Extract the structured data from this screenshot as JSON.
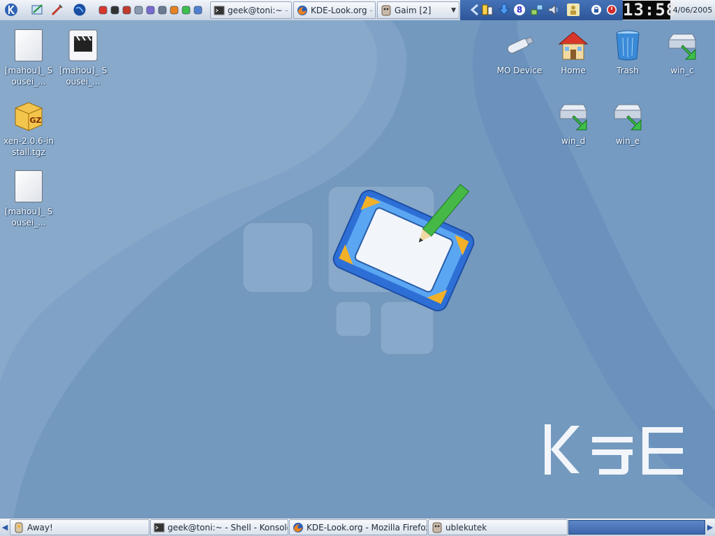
{
  "top_panel": {
    "kmenu_icon": "kde-gear-icon",
    "launchers": [
      "konqueror-icon",
      "netbeans-tools-icon",
      "globe-icon"
    ],
    "mini_launchers": [
      "home-folder-icon",
      "terminal-icon",
      "tools-icon",
      "mail-icon",
      "chat-icon",
      "speaker-icon",
      "firefox-icon",
      "network-icon",
      "browser-icon"
    ],
    "tasks": [
      {
        "label": "geek@toni:~",
        "dim": " - S",
        "icon": "terminal-icon"
      },
      {
        "label": "KDE-Look.org",
        "dim": " -",
        "icon": "firefox-icon"
      },
      {
        "label": "Gaim [2]",
        "dim": "",
        "icon": "gaim-icon"
      }
    ],
    "tray": {
      "icons": [
        "back-arrow-icon",
        "network-monitor-icon",
        "download-icon",
        "chat-count-icon",
        "network-icon",
        "volume-icon",
        "notes-icon",
        "lock-icon",
        "power-icon"
      ],
      "badge": "8"
    },
    "clock": "13:58",
    "date": "4/06/2005"
  },
  "desktop": {
    "left_icons": [
      {
        "label": "[mahou]_ Sousei_...",
        "type": "document"
      },
      {
        "label": "[mahou]_ Sousei_...",
        "type": "video"
      },
      {
        "label": "xen-2.0.6-install.tgz",
        "type": "archive"
      },
      {
        "label": "[mahou]_ Sousei_...",
        "type": "document"
      }
    ],
    "right_icons": [
      {
        "label": "MO Device",
        "type": "usb"
      },
      {
        "label": "Home",
        "type": "home"
      },
      {
        "label": "Trash",
        "type": "trash"
      },
      {
        "label": "win_c",
        "type": "drive"
      },
      {
        "label": "win_d",
        "type": "drive"
      },
      {
        "label": "win_e",
        "type": "drive"
      }
    ],
    "logo_text": "KDE",
    "archive_badge": "GZ"
  },
  "bottom_panel": {
    "tasks": [
      {
        "label": "Away!",
        "icon": "gaim-away-icon"
      },
      {
        "label": "geek@toni:~ - Shell - Konsole",
        "icon": "terminal-icon"
      },
      {
        "label": "KDE-Look.org - Mozilla Firefox",
        "icon": "firefox-icon"
      },
      {
        "label": "ublekutek",
        "icon": "gaim-icon"
      }
    ]
  },
  "colors": {
    "wallpaper_base": "#6f93b8",
    "wallpaper_light": "#86a6c8",
    "wallpaper_dark": "#4a77a6",
    "tray_blue": "#2d5698"
  }
}
